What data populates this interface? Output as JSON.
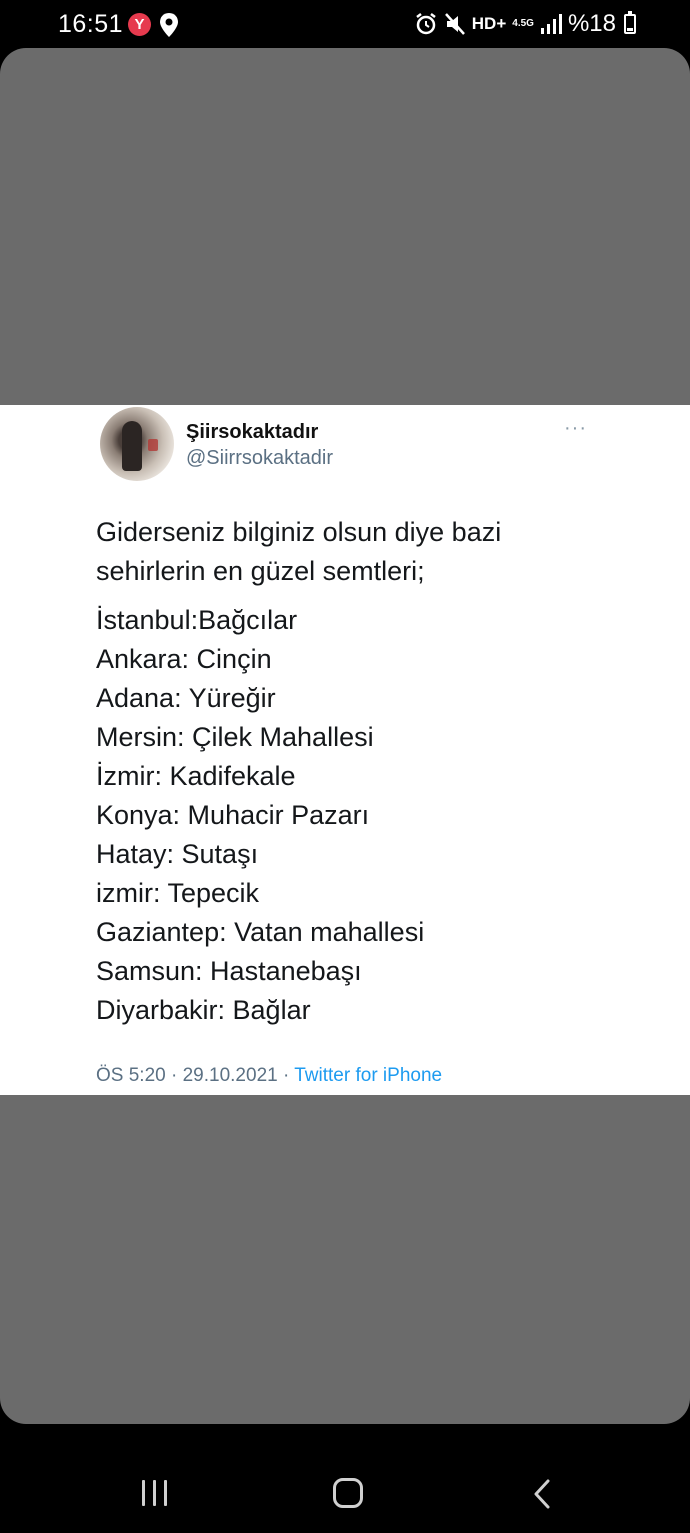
{
  "status_bar": {
    "time": "16:51",
    "notif_app_letter": "Y",
    "network_label": "HD+",
    "network_type": "4.5G",
    "battery_text": "%18",
    "icons": [
      "location-icon",
      "alarm-icon",
      "mute-icon",
      "signal-icon",
      "battery-icon"
    ]
  },
  "tweet": {
    "display_name": "Şiirsokaktadır",
    "handle": "@Siirrsokaktadir",
    "more_label": "···",
    "intro": "Giderseniz bilginiz olsun diye bazi sehirlerin en güzel semtleri;",
    "lines": [
      "İstanbul:Bağcılar",
      "Ankara: Cinçin",
      "Adana: Yüreğir",
      "Mersin: Çilek Mahallesi",
      "İzmir: Kadifekale",
      "Konya: Muhacir Pazarı",
      "Hatay: Sutaşı",
      "izmir: Tepecik",
      "Gaziantep: Vatan mahallesi",
      "Samsun: Hastanebaşı",
      "Diyarbakir: Bağlar"
    ],
    "time": "ÖS 5:20",
    "separator": "·",
    "date": "29.10.2021",
    "source": "Twitter for iPhone"
  },
  "colors": {
    "backdrop": "#6b6b6b",
    "link": "#1d9bf0",
    "muted": "#5b7083",
    "notif_badge": "#e63a4e"
  }
}
